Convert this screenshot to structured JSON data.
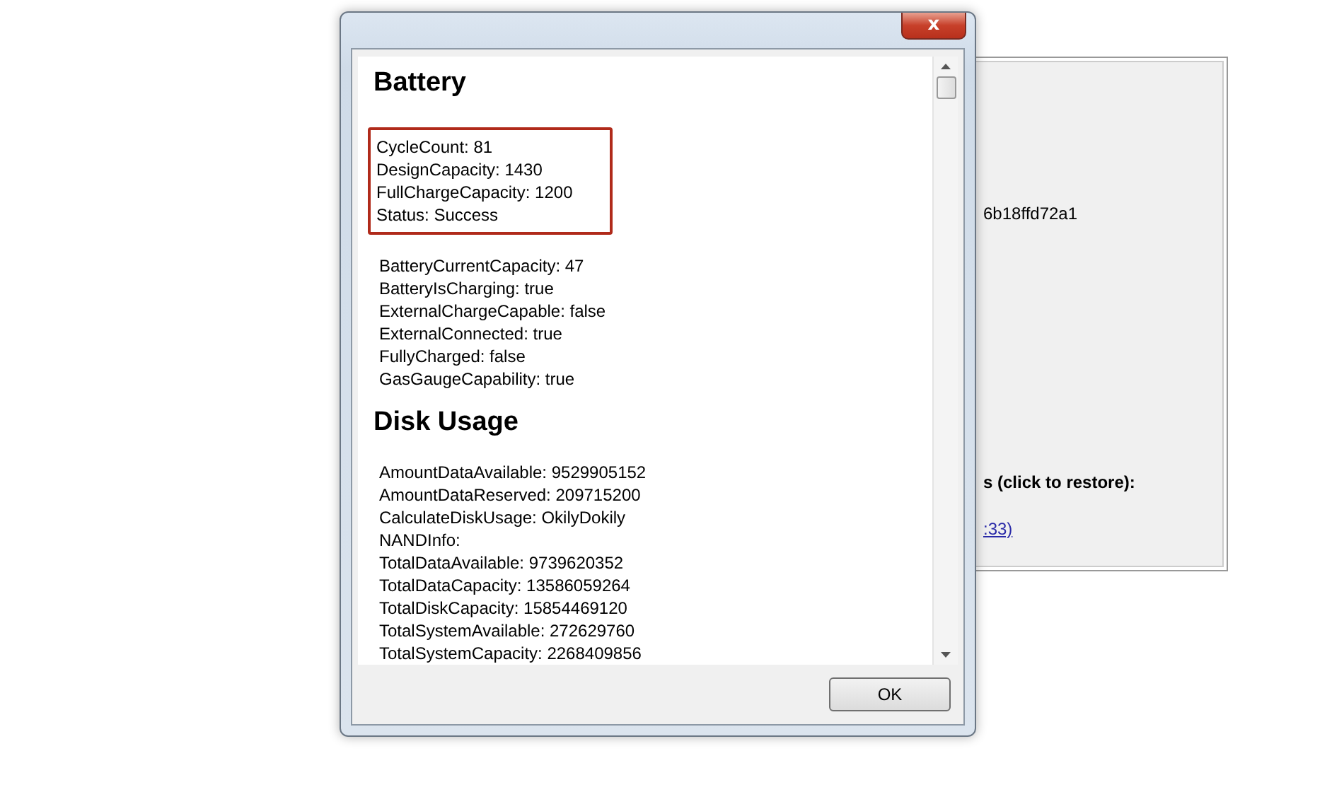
{
  "background_window": {
    "hash_text": "6b18ffd72a1",
    "restore_heading": "s (click to restore):",
    "restore_link": ":33)"
  },
  "dialog": {
    "close_label": "x",
    "sections": [
      {
        "title": "Battery",
        "groups": [
          {
            "highlighted": true,
            "lines": [
              "CycleCount: 81",
              "DesignCapacity: 1430",
              "FullChargeCapacity: 1200",
              "Status: Success"
            ]
          },
          {
            "highlighted": false,
            "lines": [
              "BatteryCurrentCapacity: 47",
              "BatteryIsCharging: true",
              "ExternalChargeCapable: false",
              "ExternalConnected: true",
              "FullyCharged: false",
              "GasGaugeCapability: true"
            ]
          }
        ]
      },
      {
        "title": "Disk Usage",
        "groups": [
          {
            "highlighted": false,
            "lines": [
              "AmountDataAvailable: 9529905152",
              "AmountDataReserved: 209715200",
              "CalculateDiskUsage: OkilyDokily",
              "NANDInfo:",
              "TotalDataAvailable: 9739620352",
              "TotalDataCapacity: 13586059264",
              "TotalDiskCapacity: 15854469120",
              "TotalSystemAvailable: 272629760",
              "TotalSystemCapacity: 2268409856"
            ]
          }
        ]
      }
    ],
    "ok_button": "OK"
  }
}
